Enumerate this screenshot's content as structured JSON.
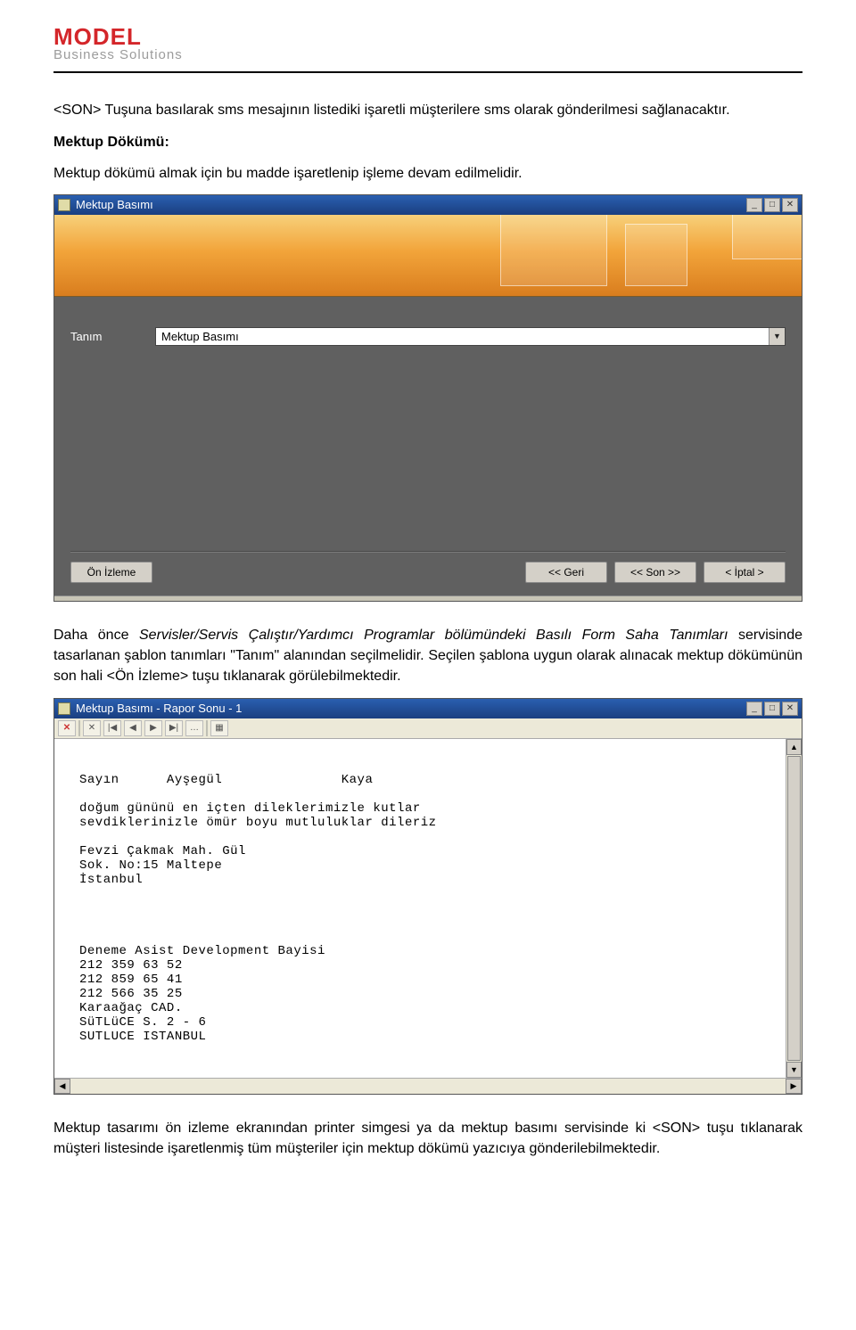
{
  "logo": {
    "main": "MODEL",
    "sub": "Business Solutions"
  },
  "para1": "<SON> Tuşuna basılarak sms mesajının listediki işaretli müşterilere sms olarak gönderilmesi sağlanacaktır.",
  "heading1": "Mektup Dökümü:",
  "para2": "Mektup dökümü almak için bu madde işaretlenip işleme devam edilmelidir.",
  "win1": {
    "title": "Mektup Basımı",
    "field_label": "Tanım",
    "field_value": "Mektup Basımı",
    "btn_preview": "Ön İzleme",
    "btn_back": "<< Geri",
    "btn_son": "<< Son >>",
    "btn_cancel": "< İptal >",
    "winbtn_min": "_",
    "winbtn_max": "□",
    "winbtn_close": "✕",
    "dd_arrow": "▼"
  },
  "para3_prefix": "Daha önce ",
  "para3_italic": "Servisler/Servis Çalıştır/Yardımcı Programlar bölümündeki Basılı Form Saha Tanımları",
  "para3_rest": " servisinde tasarlanan şablon tanımları \"Tanım\" alanından seçilmelidir. Seçilen şablona uygun olarak alınacak mektup dökümünün son hali <Ön İzleme> tuşu tıklanarak görülebilmektedir.",
  "win2": {
    "title": "Mektup Basımı - Rapor Sonu - 1",
    "winbtn_min": "_",
    "winbtn_max": "□",
    "winbtn_close": "✕",
    "tb_close": "✕",
    "tb_cut": "✕",
    "tb_first": "|◀",
    "tb_prev": "◀",
    "tb_next": "▶",
    "tb_last": "▶|",
    "tb_more": "…",
    "tb_grid": "▦",
    "scroll_up": "▲",
    "scroll_down": "▼",
    "scroll_left": "◀",
    "scroll_right": "▶",
    "report_lines": "\nSayın      Ayşegül               Kaya\n\ndoğum gününü en içten dileklerimizle kutlar\nsevdiklerinizle ömür boyu mutluluklar dileriz\n\nFevzi Çakmak Mah. Gül\nSok. No:15 Maltepe\nİstanbul\n\n\n\n\nDeneme Asist Development Bayisi\n212 359 63 52\n212 859 65 41\n212 566 35 25\nKaraağaç CAD.\nSüTLüCE S. 2 - 6\nSUTLUCE ISTANBUL"
  },
  "para4": "Mektup tasarımı ön izleme ekranından printer simgesi ya da mektup basımı servisinde ki <SON> tuşu tıklanarak müşteri listesinde işaretlenmiş tüm müşteriler için mektup dökümü yazıcıya gönderilebilmektedir."
}
